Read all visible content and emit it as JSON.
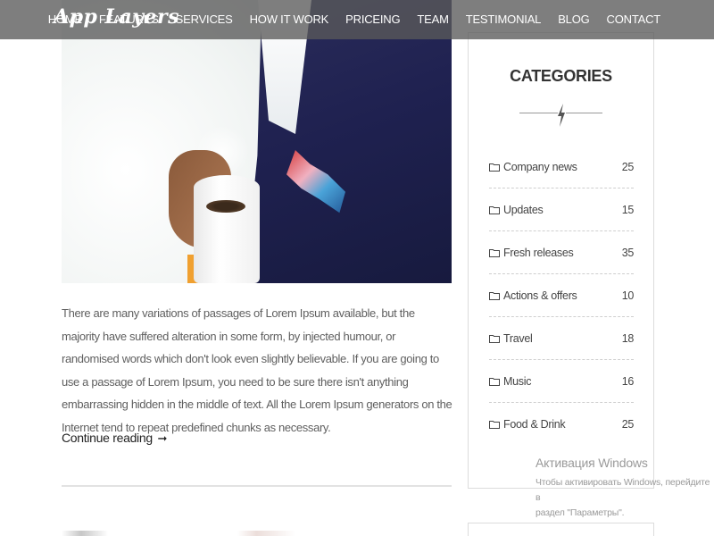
{
  "brand": {
    "logo_text": "App Layers"
  },
  "nav": {
    "items": [
      {
        "label": "HOME"
      },
      {
        "label": "FEATURES"
      },
      {
        "label": "SERVICES"
      },
      {
        "label": "HOW IT WORK"
      },
      {
        "label": "PRICEING"
      },
      {
        "label": "TEAM"
      },
      {
        "label": "TESTIMONIAL"
      },
      {
        "label": "BLOG"
      },
      {
        "label": "CONTACT"
      }
    ]
  },
  "post": {
    "body": "There are many variations of passages of Lorem Ipsum available, but the majority have suffered alteration in some form, by injected humour, or randomised words which don't look even slightly believable. If you are going to use a passage of Lorem Ipsum, you need to be sure there isn't anything embarrassing hidden in the middle of text. All the Lorem Ipsum generators on the Internet tend to repeat predefined chunks as necessary.",
    "continue_label": "Continue reading",
    "continue_arrow": "➞"
  },
  "sidebar": {
    "title": "CATEGORIES",
    "categories": [
      {
        "name": "Company news",
        "count": "25"
      },
      {
        "name": "Updates",
        "count": "15"
      },
      {
        "name": "Fresh releases",
        "count": "35"
      },
      {
        "name": "Actions & offers",
        "count": "10"
      },
      {
        "name": "Travel",
        "count": "18"
      },
      {
        "name": "Music",
        "count": "16"
      },
      {
        "name": "Food & Drink",
        "count": "25"
      }
    ]
  },
  "watermark": {
    "title": "Активация Windows",
    "line1": "Чтобы активировать Windows, перейдите в",
    "line2": "раздел \"Параметры\"."
  }
}
